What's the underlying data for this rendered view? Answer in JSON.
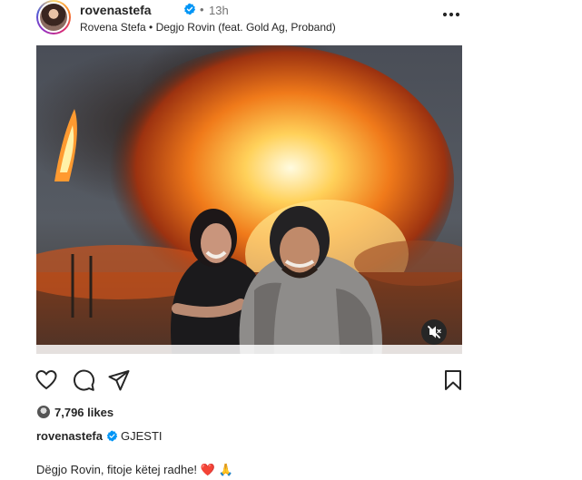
{
  "post": {
    "username": "rovenastefa",
    "separator": "•",
    "time": "13h",
    "audio": "Rovena Stefa • Degjo Rovin (feat. Gold Ag, Proband)"
  },
  "media": {
    "type": "video",
    "muted": true
  },
  "likes": {
    "text": "7,796 likes"
  },
  "caption": {
    "username": "rovenastefa",
    "text": "GJESTI",
    "line2": "Dëgjo Rovin, fitoje këtej radhe! ❤️ 🙏"
  },
  "icons": {
    "verified": "verified-badge-icon",
    "more": "more-options-icon",
    "like": "heart-icon",
    "comment": "comment-icon",
    "share": "share-icon",
    "save": "bookmark-icon",
    "mute": "speaker-muted-icon"
  },
  "colors": {
    "verified": "#0095f6",
    "text": "#262626",
    "secondary": "#737373"
  }
}
